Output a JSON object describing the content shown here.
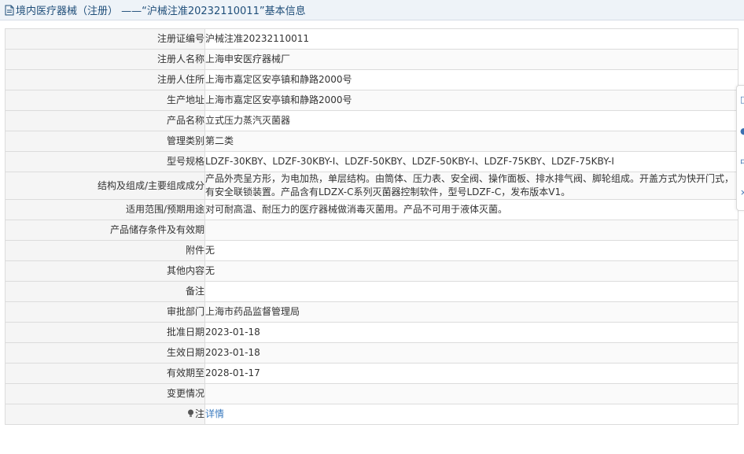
{
  "header": {
    "title": "境内医疗器械（注册） ——“沪械注准20232110011”基本信息"
  },
  "rows": [
    {
      "label": "注册证编号",
      "value": "沪械注准20232110011"
    },
    {
      "label": "注册人名称",
      "value": "上海申安医疗器械厂"
    },
    {
      "label": "注册人住所",
      "value": "上海市嘉定区安亭镇和静路2000号"
    },
    {
      "label": "生产地址",
      "value": "上海市嘉定区安亭镇和静路2000号"
    },
    {
      "label": "产品名称",
      "value": "立式压力蒸汽灭菌器"
    },
    {
      "label": "管理类别",
      "value": "第二类"
    },
    {
      "label": "型号规格",
      "value": "LDZF-30KBY、LDZF-30KBY-I、LDZF-50KBY、LDZF-50KBY-I、LDZF-75KBY、LDZF-75KBY-I"
    },
    {
      "label": "结构及组成/主要组成成分",
      "value": "产品外壳呈方形，为电加热，单层结构。由筒体、压力表、安全阀、操作面板、排水排气阀、脚轮组成。开盖方式为快开门式，有安全联锁装置。产品含有LDZX-C系列灭菌器控制软件，型号LDZF-C，发布版本V1。"
    },
    {
      "label": "适用范围/预期用途",
      "value": "对可耐高温、耐压力的医疗器械做消毒灭菌用。产品不可用于液体灭菌。"
    },
    {
      "label": "产品储存条件及有效期",
      "value": ""
    },
    {
      "label": "附件",
      "value": "无"
    },
    {
      "label": "其他内容",
      "value": "无"
    },
    {
      "label": "备注",
      "value": ""
    },
    {
      "label": "审批部门",
      "value": "上海市药品监督管理局"
    },
    {
      "label": "批准日期",
      "value": "2023-01-18"
    },
    {
      "label": "生效日期",
      "value": "2023-01-18"
    },
    {
      "label": "有效期至",
      "value": "2028-01-17"
    },
    {
      "label": "变更情况",
      "value": ""
    },
    {
      "label": "注",
      "value": "详情"
    }
  ],
  "colors": {
    "title_text": "#1f4e79",
    "link": "#3b7bbf",
    "label_bg": "#f5f5f5",
    "border": "#dcdcdc"
  },
  "icons": {
    "title": "document-icon",
    "note": "lightbulb-icon"
  }
}
